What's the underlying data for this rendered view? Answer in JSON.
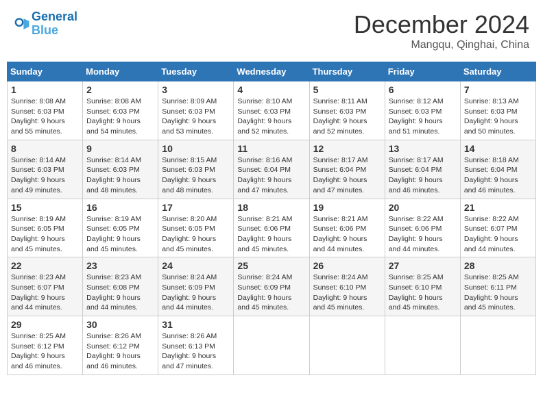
{
  "header": {
    "logo_line1": "General",
    "logo_line2": "Blue",
    "month_year": "December 2024",
    "location": "Mangqu, Qinghai, China"
  },
  "weekdays": [
    "Sunday",
    "Monday",
    "Tuesday",
    "Wednesday",
    "Thursday",
    "Friday",
    "Saturday"
  ],
  "weeks": [
    [
      {
        "day": "1",
        "sunrise": "8:08 AM",
        "sunset": "6:03 PM",
        "daylight": "9 hours and 55 minutes."
      },
      {
        "day": "2",
        "sunrise": "8:08 AM",
        "sunset": "6:03 PM",
        "daylight": "9 hours and 54 minutes."
      },
      {
        "day": "3",
        "sunrise": "8:09 AM",
        "sunset": "6:03 PM",
        "daylight": "9 hours and 53 minutes."
      },
      {
        "day": "4",
        "sunrise": "8:10 AM",
        "sunset": "6:03 PM",
        "daylight": "9 hours and 52 minutes."
      },
      {
        "day": "5",
        "sunrise": "8:11 AM",
        "sunset": "6:03 PM",
        "daylight": "9 hours and 52 minutes."
      },
      {
        "day": "6",
        "sunrise": "8:12 AM",
        "sunset": "6:03 PM",
        "daylight": "9 hours and 51 minutes."
      },
      {
        "day": "7",
        "sunrise": "8:13 AM",
        "sunset": "6:03 PM",
        "daylight": "9 hours and 50 minutes."
      }
    ],
    [
      {
        "day": "8",
        "sunrise": "8:14 AM",
        "sunset": "6:03 PM",
        "daylight": "9 hours and 49 minutes."
      },
      {
        "day": "9",
        "sunrise": "8:14 AM",
        "sunset": "6:03 PM",
        "daylight": "9 hours and 48 minutes."
      },
      {
        "day": "10",
        "sunrise": "8:15 AM",
        "sunset": "6:03 PM",
        "daylight": "9 hours and 48 minutes."
      },
      {
        "day": "11",
        "sunrise": "8:16 AM",
        "sunset": "6:04 PM",
        "daylight": "9 hours and 47 minutes."
      },
      {
        "day": "12",
        "sunrise": "8:17 AM",
        "sunset": "6:04 PM",
        "daylight": "9 hours and 47 minutes."
      },
      {
        "day": "13",
        "sunrise": "8:17 AM",
        "sunset": "6:04 PM",
        "daylight": "9 hours and 46 minutes."
      },
      {
        "day": "14",
        "sunrise": "8:18 AM",
        "sunset": "6:04 PM",
        "daylight": "9 hours and 46 minutes."
      }
    ],
    [
      {
        "day": "15",
        "sunrise": "8:19 AM",
        "sunset": "6:05 PM",
        "daylight": "9 hours and 45 minutes."
      },
      {
        "day": "16",
        "sunrise": "8:19 AM",
        "sunset": "6:05 PM",
        "daylight": "9 hours and 45 minutes."
      },
      {
        "day": "17",
        "sunrise": "8:20 AM",
        "sunset": "6:05 PM",
        "daylight": "9 hours and 45 minutes."
      },
      {
        "day": "18",
        "sunrise": "8:21 AM",
        "sunset": "6:06 PM",
        "daylight": "9 hours and 45 minutes."
      },
      {
        "day": "19",
        "sunrise": "8:21 AM",
        "sunset": "6:06 PM",
        "daylight": "9 hours and 44 minutes."
      },
      {
        "day": "20",
        "sunrise": "8:22 AM",
        "sunset": "6:06 PM",
        "daylight": "9 hours and 44 minutes."
      },
      {
        "day": "21",
        "sunrise": "8:22 AM",
        "sunset": "6:07 PM",
        "daylight": "9 hours and 44 minutes."
      }
    ],
    [
      {
        "day": "22",
        "sunrise": "8:23 AM",
        "sunset": "6:07 PM",
        "daylight": "9 hours and 44 minutes."
      },
      {
        "day": "23",
        "sunrise": "8:23 AM",
        "sunset": "6:08 PM",
        "daylight": "9 hours and 44 minutes."
      },
      {
        "day": "24",
        "sunrise": "8:24 AM",
        "sunset": "6:09 PM",
        "daylight": "9 hours and 44 minutes."
      },
      {
        "day": "25",
        "sunrise": "8:24 AM",
        "sunset": "6:09 PM",
        "daylight": "9 hours and 45 minutes."
      },
      {
        "day": "26",
        "sunrise": "8:24 AM",
        "sunset": "6:10 PM",
        "daylight": "9 hours and 45 minutes."
      },
      {
        "day": "27",
        "sunrise": "8:25 AM",
        "sunset": "6:10 PM",
        "daylight": "9 hours and 45 minutes."
      },
      {
        "day": "28",
        "sunrise": "8:25 AM",
        "sunset": "6:11 PM",
        "daylight": "9 hours and 45 minutes."
      }
    ],
    [
      {
        "day": "29",
        "sunrise": "8:25 AM",
        "sunset": "6:12 PM",
        "daylight": "9 hours and 46 minutes."
      },
      {
        "day": "30",
        "sunrise": "8:26 AM",
        "sunset": "6:12 PM",
        "daylight": "9 hours and 46 minutes."
      },
      {
        "day": "31",
        "sunrise": "8:26 AM",
        "sunset": "6:13 PM",
        "daylight": "9 hours and 47 minutes."
      },
      null,
      null,
      null,
      null
    ]
  ]
}
